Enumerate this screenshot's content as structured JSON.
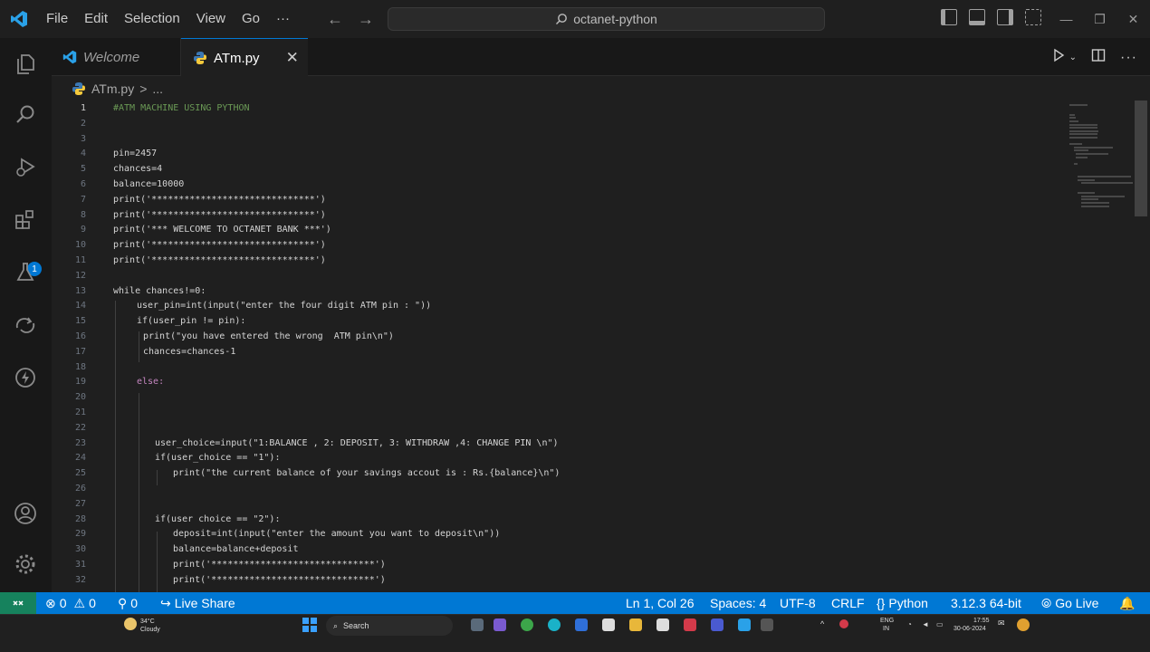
{
  "menu": [
    "File",
    "Edit",
    "Selection",
    "View",
    "Go",
    "···"
  ],
  "search": {
    "text": "octanet-python"
  },
  "tabs": {
    "welcome": "Welcome",
    "active": "ATm.py",
    "close": "✕"
  },
  "breadcrumb": {
    "file": "ATm.py",
    "sep": ">",
    "rest": "..."
  },
  "activity_badge": "1",
  "code": [
    {
      "n": "1",
      "t": "#ATM MACHINE USING PYTHON",
      "c": "#6a9955",
      "ind": 0
    },
    {
      "n": "2",
      "t": "",
      "c": "#d4d4d4",
      "ind": 0
    },
    {
      "n": "3",
      "t": "",
      "c": "#d4d4d4",
      "ind": 0
    },
    {
      "n": "4",
      "t": "pin=2457",
      "c": "#d4d4d4",
      "ind": 0
    },
    {
      "n": "5",
      "t": "chances=4",
      "c": "#d4d4d4",
      "ind": 0
    },
    {
      "n": "6",
      "t": "balance=10000",
      "c": "#d4d4d4",
      "ind": 0
    },
    {
      "n": "7",
      "t": "print('******************************')",
      "c": "#d4d4d4",
      "ind": 0
    },
    {
      "n": "8",
      "t": "print('******************************')",
      "c": "#d4d4d4",
      "ind": 0
    },
    {
      "n": "9",
      "t": "print('*** WELCOME TO OCTANET BANK ***')",
      "c": "#d4d4d4",
      "ind": 0
    },
    {
      "n": "10",
      "t": "print('******************************')",
      "c": "#d4d4d4",
      "ind": 0
    },
    {
      "n": "11",
      "t": "print('******************************')",
      "c": "#d4d4d4",
      "ind": 0
    },
    {
      "n": "12",
      "t": "",
      "c": "#d4d4d4",
      "ind": 0
    },
    {
      "n": "13",
      "t": "while chances!=0:",
      "c": "#d4d4d4",
      "ind": 0
    },
    {
      "n": "14",
      "t": "user_pin=int(input(\"enter the four digit ATM pin : \"))",
      "c": "#d4d4d4",
      "ind": 26
    },
    {
      "n": "15",
      "t": "if(user_pin != pin):",
      "c": "#d4d4d4",
      "ind": 26
    },
    {
      "n": "16",
      "t": "print(\"you have entered the wrong  ATM pin\\n\")",
      "c": "#d4d4d4",
      "ind": 33
    },
    {
      "n": "17",
      "t": "chances=chances-1",
      "c": "#d4d4d4",
      "ind": 33
    },
    {
      "n": "18",
      "t": "",
      "c": "#d4d4d4",
      "ind": 0
    },
    {
      "n": "19",
      "t": "else:",
      "c": "#c586c0",
      "ind": 26
    },
    {
      "n": "20",
      "t": "",
      "c": "#d4d4d4",
      "ind": 0
    },
    {
      "n": "21",
      "t": "",
      "c": "#d4d4d4",
      "ind": 0
    },
    {
      "n": "22",
      "t": "",
      "c": "#d4d4d4",
      "ind": 0
    },
    {
      "n": "23",
      "t": "user_choice=input(\"1:BALANCE , 2: DEPOSIT, 3: WITHDRAW ,4: CHANGE PIN \\n\")",
      "c": "#d4d4d4",
      "ind": 46
    },
    {
      "n": "24",
      "t": "if(user_choice == \"1\"):",
      "c": "#d4d4d4",
      "ind": 46
    },
    {
      "n": "25",
      "t": "print(\"the current balance of your savings accout is : Rs.{balance}\\n\")",
      "c": "#d4d4d4",
      "ind": 66
    },
    {
      "n": "26",
      "t": "",
      "c": "#d4d4d4",
      "ind": 0
    },
    {
      "n": "27",
      "t": "",
      "c": "#d4d4d4",
      "ind": 0
    },
    {
      "n": "28",
      "t": "if(user choice == \"2\"):",
      "c": "#d4d4d4",
      "ind": 46
    },
    {
      "n": "29",
      "t": "deposit=int(input(\"enter the amount you want to deposit\\n\"))",
      "c": "#d4d4d4",
      "ind": 66
    },
    {
      "n": "30",
      "t": "balance=balance+deposit",
      "c": "#d4d4d4",
      "ind": 66
    },
    {
      "n": "31",
      "t": "print('******************************')",
      "c": "#d4d4d4",
      "ind": 66
    },
    {
      "n": "32",
      "t": "print('******************************')",
      "c": "#d4d4d4",
      "ind": 66
    }
  ],
  "status": {
    "errors": "0",
    "warnings": "0",
    "ports": "0",
    "live_share": "Live Share",
    "position": "Ln 1, Col 26",
    "spaces": "Spaces: 4",
    "encoding": "UTF-8",
    "eol": "CRLF",
    "language": "Python",
    "interpreter": "3.12.3 64-bit",
    "go_live": "Go Live"
  },
  "taskbar": {
    "weather_temp": "34°C",
    "weather_desc": "Cloudy",
    "search": "Search",
    "lang1": "ENG",
    "lang2": "IN",
    "time": "17:55",
    "date": "30-06-2024"
  },
  "colors": {
    "accent": "#0078d4",
    "remote": "#16825d",
    "editor_bg": "#1f1f1f"
  }
}
